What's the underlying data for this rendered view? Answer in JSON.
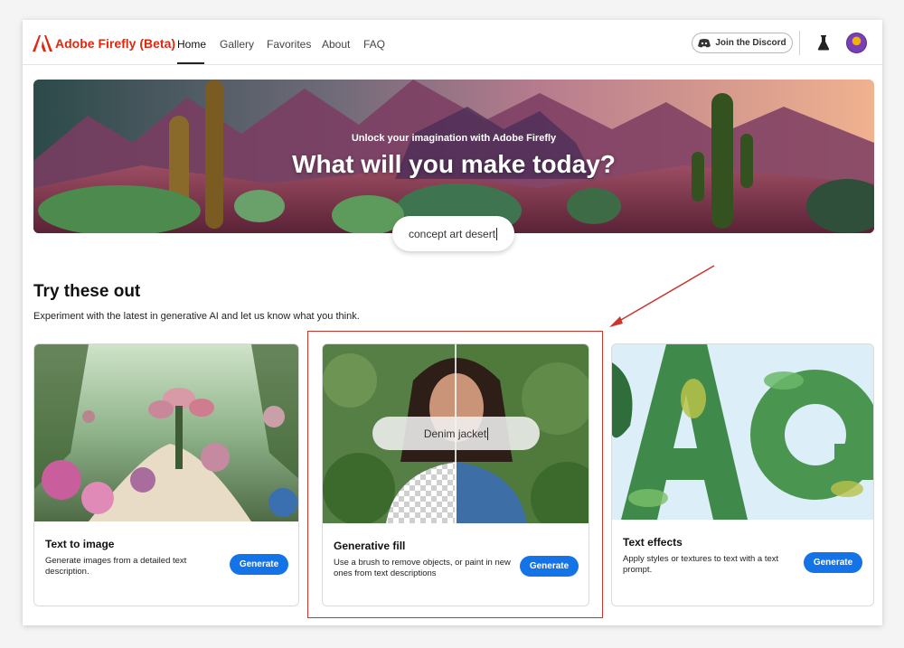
{
  "header": {
    "brand": "Adobe Firefly (Beta)",
    "nav": [
      "Home",
      "Gallery",
      "Favorites",
      "About",
      "FAQ"
    ],
    "active_nav": "Home",
    "discord_label": "Join the Discord"
  },
  "hero": {
    "subtitle": "Unlock your imagination with Adobe Firefly",
    "title": "What will you make today?",
    "search_value": "concept art desert"
  },
  "section": {
    "title": "Try these out",
    "description": "Experiment with the latest in generative AI and let us know what you think."
  },
  "cards": [
    {
      "title": "Text to image",
      "description": "Generate images from a detailed text description.",
      "button": "Generate"
    },
    {
      "title": "Generative fill",
      "description": "Use a brush to remove objects, or paint in new ones from text descriptions",
      "button": "Generate",
      "prompt": "Denim jacket"
    },
    {
      "title": "Text effects",
      "description": "Apply styles or textures to text with a text prompt.",
      "button": "Generate"
    }
  ],
  "colors": {
    "brand": "#e0280f",
    "accent": "#1473e6",
    "annotation": "#c8362d"
  }
}
